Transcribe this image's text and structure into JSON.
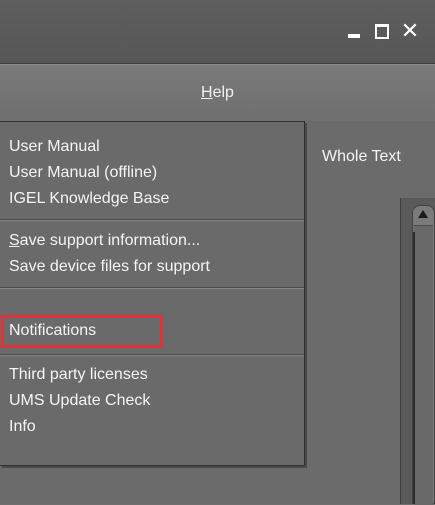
{
  "window": {
    "controls": {
      "minimize_icon": "minimize-icon",
      "maximize_icon": "maximize-icon",
      "close_icon": "close-icon",
      "close_glyph": "✕"
    }
  },
  "menubar": {
    "help": {
      "mnemonic": "H",
      "rest": "elp"
    }
  },
  "content": {
    "tab_label": "Whole Text"
  },
  "help_menu": {
    "groups": [
      [
        {
          "label": "User Manual"
        },
        {
          "label": "User Manual (offline)"
        },
        {
          "label": "IGEL Knowledge Base"
        }
      ],
      [
        {
          "mnemonic": "S",
          "rest": "ave support information..."
        },
        {
          "label": "Save device files for support"
        }
      ],
      [
        {
          "label": "Notifications",
          "highlighted": true
        }
      ],
      [
        {
          "label": "Third party licenses"
        },
        {
          "label": "UMS Update Check"
        },
        {
          "label": "Info"
        }
      ]
    ]
  },
  "colors": {
    "highlight_border": "#e0343a",
    "menu_bg": "#6a6a6a",
    "text": "#f5f5f5"
  }
}
